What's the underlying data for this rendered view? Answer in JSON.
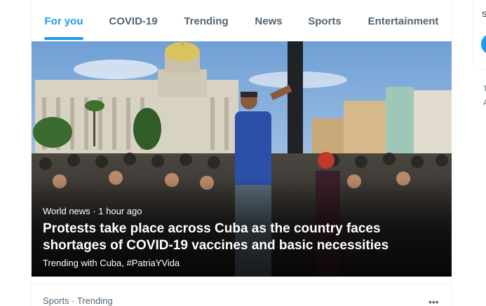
{
  "tabs": [
    {
      "label": "For you",
      "active": true
    },
    {
      "label": "COVID-19",
      "active": false
    },
    {
      "label": "Trending",
      "active": false
    },
    {
      "label": "News",
      "active": false
    },
    {
      "label": "Sports",
      "active": false
    },
    {
      "label": "Entertainment",
      "active": false
    }
  ],
  "hero": {
    "category": "World news",
    "separator": "·",
    "time": "1 hour ago",
    "title": "Protests take place across Cuba as the country faces shortages of COVID-19 vaccines and basic necessities",
    "trending_prefix": "Trending with",
    "trending_tags": [
      "Cuba,",
      "#PatriaYVida"
    ]
  },
  "next_item": {
    "meta": "Sports · Trending",
    "more_icon": "more-dots-icon"
  },
  "right_sidebar": {
    "partial_text_1": "S",
    "partial_text_2": "T",
    "partial_text_3": "A"
  },
  "colors": {
    "accent": "#1d9bf0",
    "secondary_text": "#536471",
    "primary_text": "#0f1419",
    "border": "#eff3f4"
  }
}
